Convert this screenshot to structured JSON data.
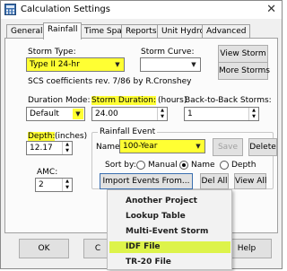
{
  "window": {
    "title": "Calculation Settings",
    "close_glyph": "✕",
    "icon": "calculator-app-icon"
  },
  "tabs": [
    "General",
    "Rainfall",
    "Time Span",
    "Reports",
    "Unit Hydro",
    "Advanced"
  ],
  "active_tab": "Rainfall",
  "storm_type": {
    "label": "Storm Type:",
    "value": "Type II 24-hr"
  },
  "storm_curve": {
    "label": "Storm Curve:",
    "value": ""
  },
  "buttons": {
    "view_storm": "View Storm",
    "more_storms": "More Storms",
    "save": "Save",
    "delete": "Delete",
    "import_events": "Import Events From...",
    "del_all": "Del All",
    "view_all": "View All",
    "ok": "OK",
    "cancel_partial": "C",
    "help": "Help"
  },
  "scs_note": "SCS coefficients rev. 7/86 by R.Cronshey",
  "duration_mode": {
    "label": "Duration Mode:",
    "value": "Default"
  },
  "storm_duration": {
    "label": "Storm Duration:",
    "unit": "(hours)",
    "value": "24.00"
  },
  "back_to_back": {
    "label": "Back-to-Back Storms:",
    "value": "1"
  },
  "depth": {
    "label": "Depth:",
    "unit": "(inches)",
    "value": "12.17"
  },
  "amc": {
    "label": "AMC:",
    "value": "2"
  },
  "rainfall_event": {
    "group_title": "Rainfall Event",
    "name_label": "Name:",
    "name_value": "100-Year",
    "sort_by_label": "Sort by:",
    "sort_options": [
      "Manual",
      "Name",
      "Depth"
    ],
    "sort_selected": "Name"
  },
  "import_menu": {
    "items": [
      "Another Project",
      "Lookup Table",
      "Multi-Event Storm",
      "IDF File",
      "TR-20 File"
    ],
    "highlighted": "IDF File"
  },
  "colors": {
    "highlight": "#ffff33",
    "menu_highlight": "#ddf34a"
  }
}
